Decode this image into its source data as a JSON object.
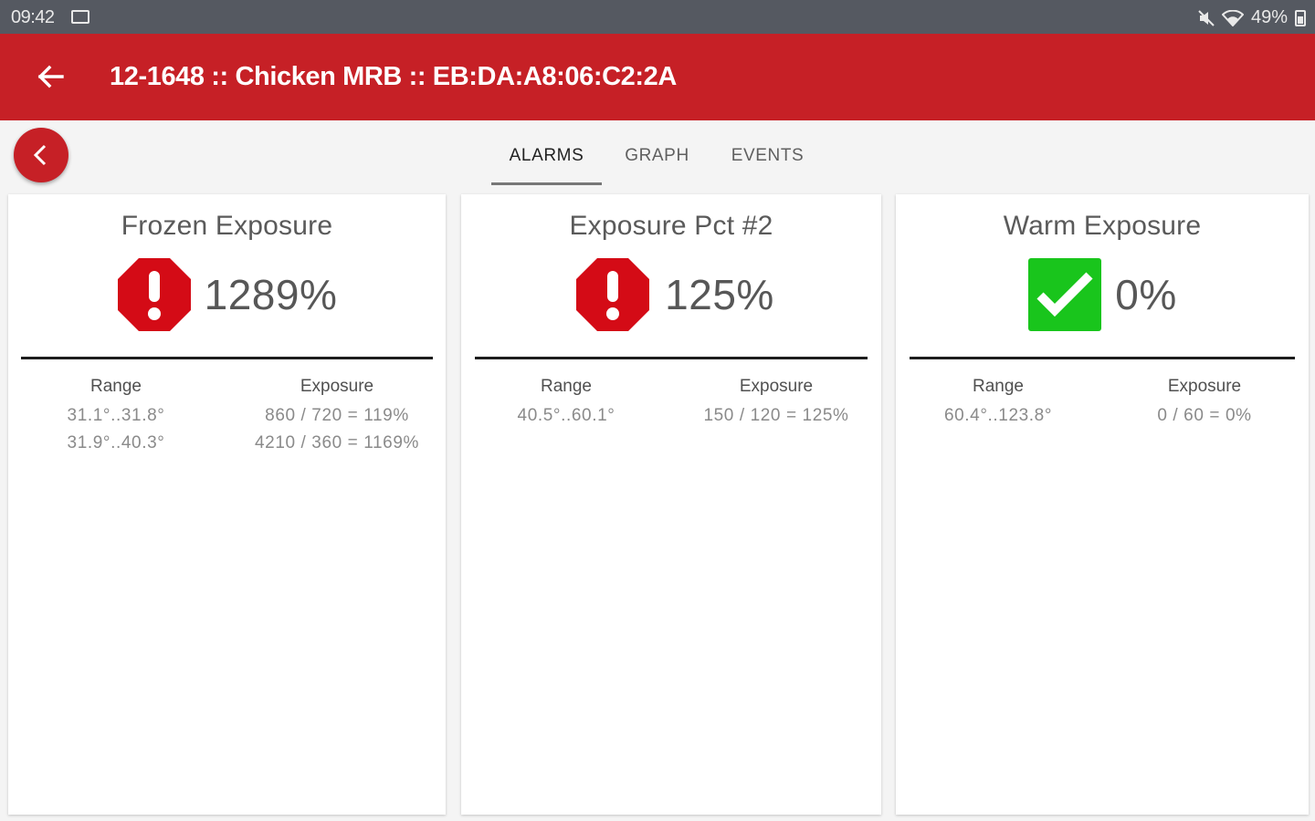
{
  "status_bar": {
    "time": "09:42",
    "battery": "49%",
    "icons": [
      "mail-icon",
      "mute-icon",
      "wifi-icon",
      "battery-icon"
    ]
  },
  "app_bar": {
    "title": "12-1648 :: Chicken MRB :: EB:DA:A8:06:C2:2A",
    "color": "#c62026"
  },
  "tabs": [
    {
      "label": "ALARMS",
      "active": true
    },
    {
      "label": "GRAPH",
      "active": false
    },
    {
      "label": "EVENTS",
      "active": false
    }
  ],
  "cards": [
    {
      "title": "Frozen Exposure",
      "status": "alarm",
      "status_icon": "alarm-octagon-icon",
      "value": "1289%",
      "range_header": "Range",
      "exposure_header": "Exposure",
      "rows": [
        {
          "range": "31.1°..31.8°",
          "exposure": "860 / 720 = 119%"
        },
        {
          "range": "31.9°..40.3°",
          "exposure": "4210 / 360 = 1169%"
        }
      ]
    },
    {
      "title": "Exposure Pct #2",
      "status": "alarm",
      "status_icon": "alarm-octagon-icon",
      "value": "125%",
      "range_header": "Range",
      "exposure_header": "Exposure",
      "rows": [
        {
          "range": "40.5°..60.1°",
          "exposure": "150 / 120 = 125%"
        }
      ]
    },
    {
      "title": "Warm Exposure",
      "status": "ok",
      "status_icon": "checkmark-icon",
      "value": "0%",
      "range_header": "Range",
      "exposure_header": "Exposure",
      "rows": [
        {
          "range": "60.4°..123.8°",
          "exposure": "0 / 60 = 0%"
        }
      ]
    }
  ],
  "colors": {
    "alarm": "#d40b16",
    "ok": "#19c51c"
  }
}
